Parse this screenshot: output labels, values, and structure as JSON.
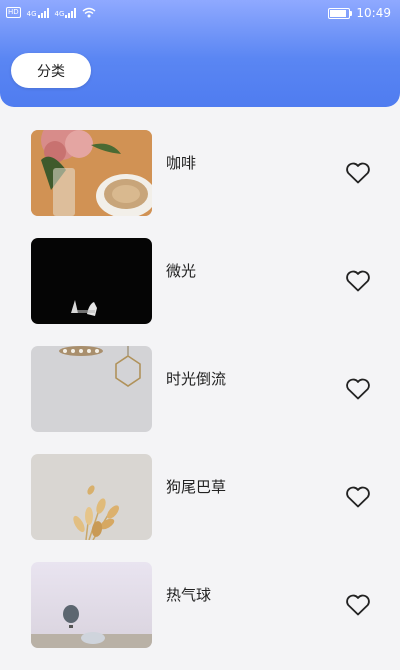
{
  "status_bar": {
    "time": "10:49",
    "badge": "HD",
    "signal_labels": [
      "4G",
      "4G"
    ]
  },
  "header": {
    "category_button": "分类"
  },
  "items": [
    {
      "title": "咖啡",
      "image": "coffee-photo",
      "favorite": false
    },
    {
      "title": "微光",
      "image": "dark-photo",
      "favorite": false
    },
    {
      "title": "时光倒流",
      "image": "wall-ornament-photo",
      "favorite": false
    },
    {
      "title": "狗尾巴草",
      "image": "dried-grass-photo",
      "favorite": false
    },
    {
      "title": "热气球",
      "image": "hot-air-balloon-photo",
      "favorite": false
    }
  ],
  "colors": {
    "header_gradient_top": "#8fa9ff",
    "header_gradient_bottom": "#4f7cf0",
    "background": "#f4f4f6"
  }
}
